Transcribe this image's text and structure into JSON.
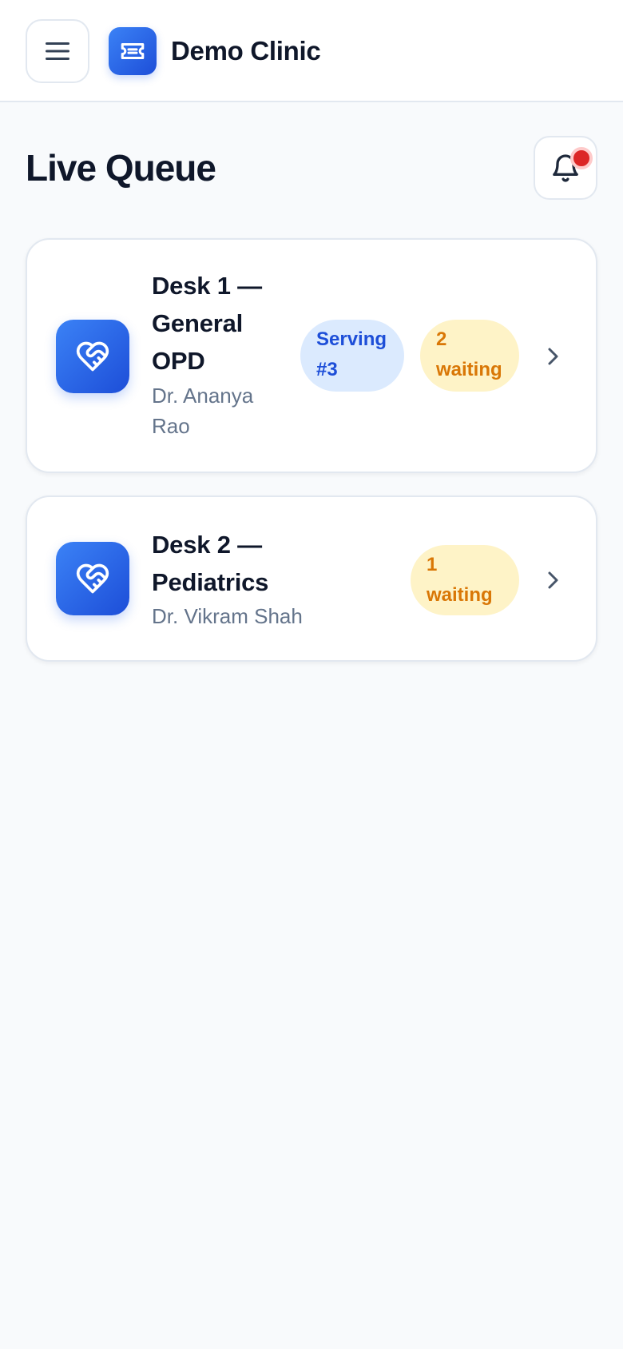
{
  "header": {
    "menu_icon": "hamburger-menu-icon",
    "brand_icon": "ticket-icon",
    "brand_name": "Demo Clinic"
  },
  "page": {
    "title": "Live Queue",
    "notification_icon": "bell-icon",
    "has_unread_notification": true
  },
  "desks": [
    {
      "icon": "heart-handshake-icon",
      "name": "Desk 1 — General OPD",
      "doctor": "Dr. Ananya Rao",
      "serving": "Serving #3",
      "waiting": "2 waiting"
    },
    {
      "icon": "heart-handshake-icon",
      "name": "Desk 2 — Pediatrics",
      "doctor": "Dr. Vikram Shah",
      "waiting": "1 waiting"
    }
  ],
  "colors": {
    "accent": "#2563eb",
    "serving_bg": "#dbeafe",
    "serving_text": "#1d4ed8",
    "waiting_bg": "#fef3c7",
    "waiting_text": "#d97706",
    "notification_dot": "#dc2626",
    "background": "#f8fafc"
  }
}
